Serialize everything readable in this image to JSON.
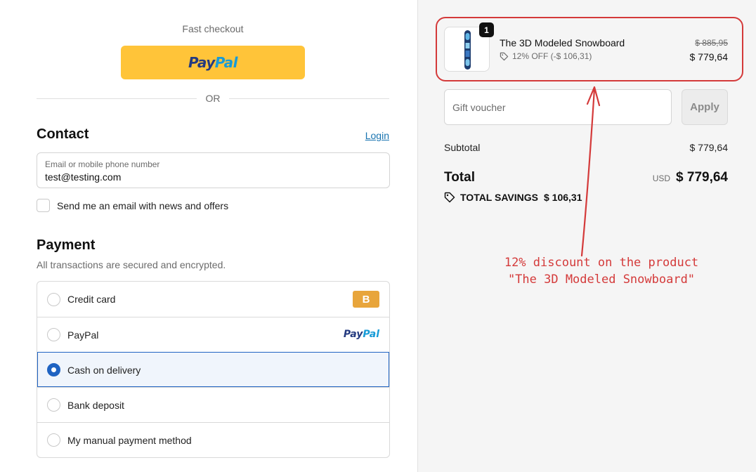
{
  "fast_checkout": {
    "label": "Fast checkout",
    "paypal_part1": "Pay",
    "paypal_part2": "Pal",
    "or_label": "OR"
  },
  "contact": {
    "title": "Contact",
    "login_label": "Login",
    "email_label": "Email or mobile phone number",
    "email_value": "test@testing.com",
    "newsletter_label": "Send me an email with news and offers"
  },
  "payment": {
    "title": "Payment",
    "subtitle": "All transactions are secured and encrypted.",
    "options": [
      {
        "label": "Credit card",
        "badge": "B",
        "selected": false
      },
      {
        "label": "PayPal",
        "logo_a": "Pay",
        "logo_b": "Pal",
        "selected": false
      },
      {
        "label": "Cash on delivery",
        "selected": true
      },
      {
        "label": "Bank deposit",
        "selected": false
      },
      {
        "label": "My manual payment method",
        "selected": false
      }
    ]
  },
  "order": {
    "product": {
      "quantity": "1",
      "name": "The 3D Modeled Snowboard",
      "discount": "12% OFF (-$ 106,31)",
      "original_price": "$ 885,95",
      "price": "$ 779,64"
    },
    "voucher_placeholder": "Gift voucher",
    "apply_label": "Apply",
    "subtotal_label": "Subtotal",
    "subtotal_value": "$ 779,64",
    "total_label": "Total",
    "total_currency": "USD",
    "total_value": "$ 779,64",
    "savings_label": "TOTAL SAVINGS",
    "savings_value": "$ 106,31"
  },
  "annotation": {
    "line1": "12% discount on the product",
    "line2": "\"The 3D Modeled Snowboard\""
  },
  "colors": {
    "paypal_yellow": "#ffc439",
    "accent_blue": "#1f63c2",
    "annotation_red": "#d43a3a",
    "badge_orange": "#e8a53b"
  }
}
